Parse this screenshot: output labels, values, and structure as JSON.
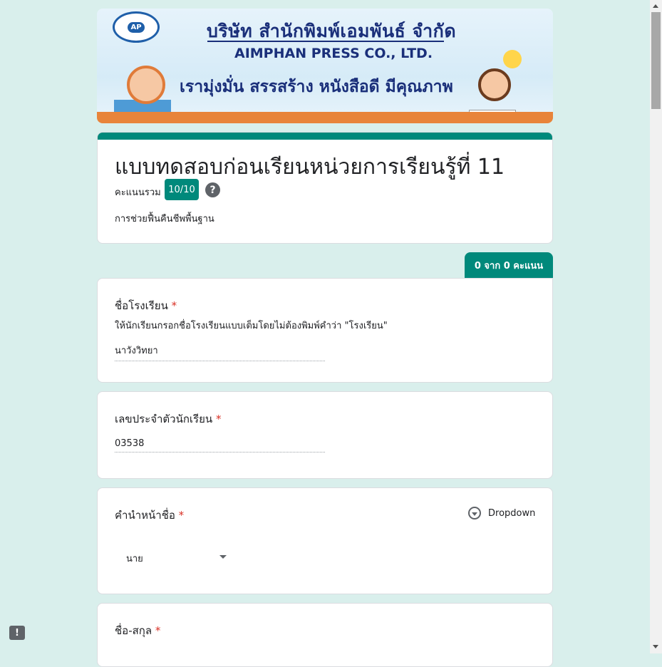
{
  "banner": {
    "logo_text": "AP",
    "line1": "บริษัท สำนักพิมพ์เอมพันธ์ จำกัด",
    "line2": "AIMPHAN PRESS CO., LTD.",
    "line3": "เรามุ่งมั่น สรรสร้าง หนังสือดี มีคุณภาพ"
  },
  "form": {
    "title": "แบบทดสอบก่อนเรียนหน่วยการเรียนรู้ที่ 11",
    "score_label": "คะแนนรวม",
    "score_value": "10/10",
    "help_glyph": "?",
    "description": "การช่วยฟื้นคืนชีพพื้นฐาน",
    "points_tab": "0 จาก 0 คะแนน"
  },
  "questions": [
    {
      "title": "ชื่อโรงเรียน",
      "required_mark": "*",
      "description": "ให้นักเรียนกรอกชื่อโรงเรียนแบบเต็มโดยไม่ต้องพิมพ์คำว่า \"โรงเรียน\"",
      "answer": "นาวังวิทยา"
    },
    {
      "title": "เลขประจำตัวนักเรียน",
      "required_mark": "*",
      "answer": "03538"
    },
    {
      "title": "คำนำหน้าชื่อ",
      "required_mark": "*",
      "type_label": "Dropdown",
      "selected": "นาย"
    },
    {
      "title": "ชื่อ-สกุล",
      "required_mark": "*"
    }
  ],
  "icons": {
    "feedback": "report-icon",
    "help": "help-icon",
    "dropdown": "dropdown-circle-icon"
  },
  "colors": {
    "accent": "#00897b",
    "background": "#d9efec",
    "required": "#d93025"
  }
}
